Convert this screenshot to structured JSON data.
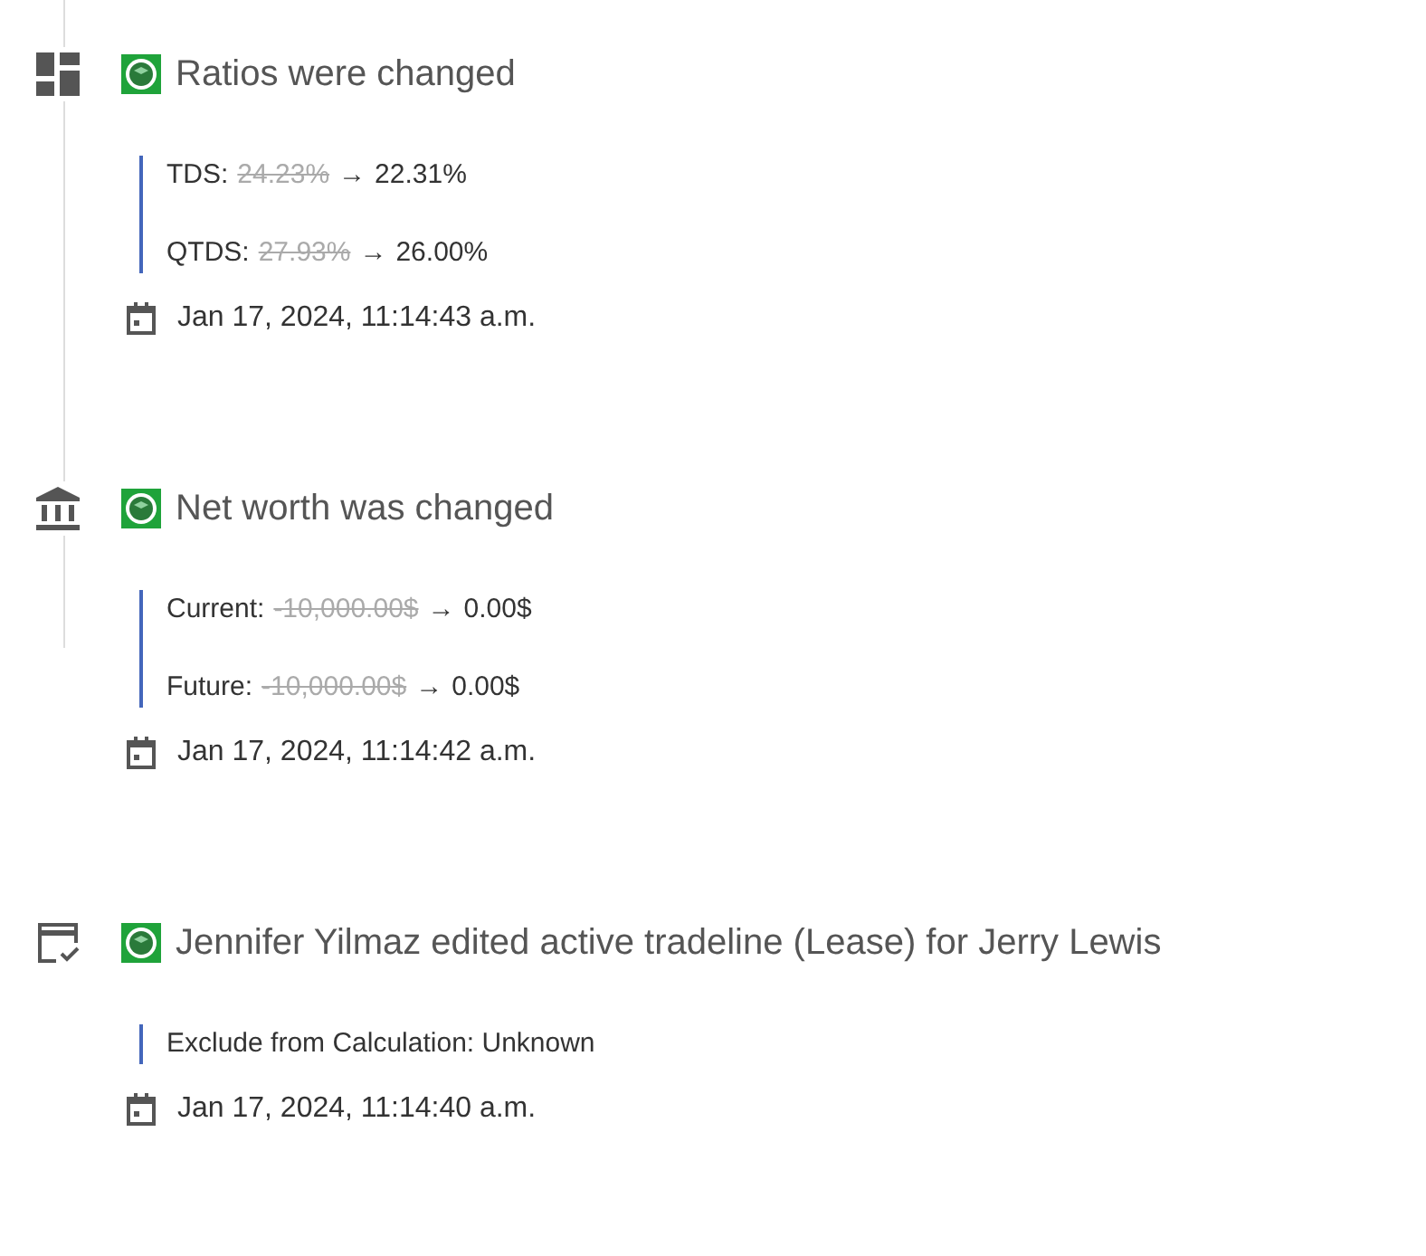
{
  "entries": [
    {
      "kind": "ratios",
      "title": "Ratios were changed",
      "changes": [
        {
          "kind": "change",
          "label": "TDS:",
          "old": "24.23%",
          "arrow": "→",
          "new": "22.31%"
        },
        {
          "kind": "change",
          "label": "QTDS:",
          "old": "27.93%",
          "arrow": "→",
          "new": "26.00%"
        }
      ],
      "date": "Jan 17, 2024, 11:14:43 a.m."
    },
    {
      "kind": "networth",
      "title": "Net worth was changed",
      "changes": [
        {
          "kind": "change",
          "label": "Current:",
          "old": "-10,000.00$",
          "arrow": "→",
          "new": "0.00$"
        },
        {
          "kind": "change",
          "label": "Future:",
          "old": "-10,000.00$",
          "arrow": "→",
          "new": "0.00$"
        }
      ],
      "date": "Jan 17, 2024, 11:14:42 a.m."
    },
    {
      "kind": "tradeline",
      "title": "Jennifer Yilmaz edited active tradeline (Lease) for Jerry Lewis",
      "changes": [
        {
          "kind": "plain",
          "text": "Exclude from Calculation: Unknown"
        }
      ],
      "date": "Jan 17, 2024, 11:14:40 a.m."
    }
  ]
}
